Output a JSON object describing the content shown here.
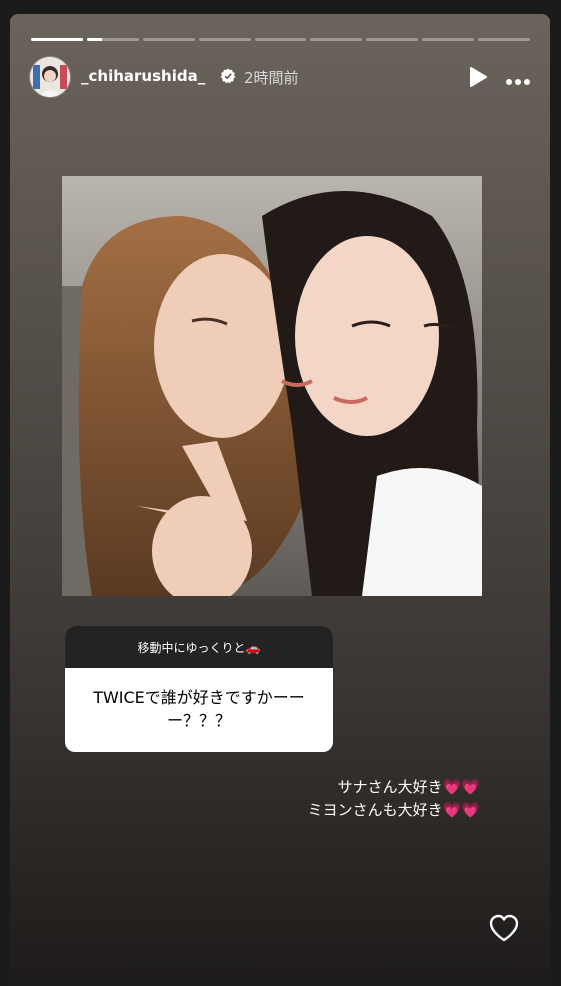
{
  "progress": {
    "segments": 9,
    "active_index": 1,
    "active_fraction": 0.3
  },
  "user": {
    "handle": "_chiharushida_",
    "verified": true,
    "time_ago": "2時間前"
  },
  "question_sticker": {
    "header": "移動中にゆっくりと🚗",
    "question": "TWICEで誰が好きですかーーー？？？"
  },
  "caption": {
    "line1": "サナさん大好き💗💗",
    "line2": "ミヨンさんも大好き💗💗"
  },
  "icons": {
    "verified": "verified-badge-icon",
    "play": "play-icon",
    "more": "more-horizontal-icon",
    "like": "heart-outline-icon"
  },
  "colors": {
    "progress_fill": "#ffffff",
    "sticker_header_bg": "#232323"
  }
}
